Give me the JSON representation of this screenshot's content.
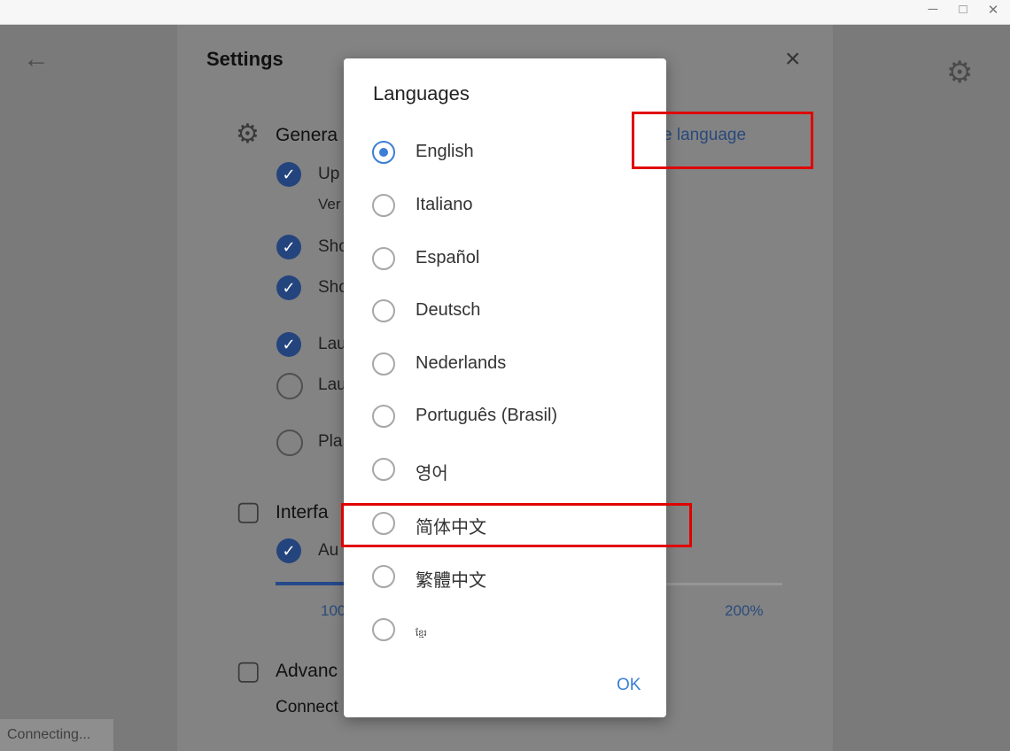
{
  "window": {
    "minimize_icon": "minimize-icon",
    "maximize_icon": "maximize-icon",
    "close_icon": "close-icon"
  },
  "settings": {
    "title": "Settings",
    "general": {
      "title": "Genera",
      "options": [
        {
          "label": "Up",
          "checked": true
        },
        {
          "label": "Ver",
          "checked": null
        },
        {
          "label": "Sho",
          "checked": true
        },
        {
          "label": "Sho",
          "checked": true
        },
        {
          "label": "Lau",
          "checked": true
        },
        {
          "label": "Lau",
          "checked": false
        },
        {
          "label": "Pla",
          "checked": false
        }
      ],
      "change_language": "e language"
    },
    "interface": {
      "title": "Interfa",
      "option": {
        "label": "Au",
        "checked": true
      },
      "slider_min": "100",
      "slider_max": "200%",
      "slider_value_fraction": 0.14
    },
    "advanced": {
      "title": "Advanc",
      "connect_label": "Connect"
    }
  },
  "status_bar": "Connecting...",
  "dialog": {
    "title": "Languages",
    "ok": "OK",
    "languages": [
      {
        "label": "English",
        "selected": true
      },
      {
        "label": "Italiano",
        "selected": false
      },
      {
        "label": "Español",
        "selected": false
      },
      {
        "label": "Deutsch",
        "selected": false
      },
      {
        "label": "Nederlands",
        "selected": false
      },
      {
        "label": "Português (Brasil)",
        "selected": false
      },
      {
        "label": "영어",
        "selected": false
      },
      {
        "label": "简体中文",
        "selected": false
      },
      {
        "label": "繁體中文",
        "selected": false
      },
      {
        "label": "ខ្មែរ",
        "selected": false
      }
    ]
  },
  "colors": {
    "accent": "#3a7fd5",
    "check": "#24447e",
    "highlight_box": "#e00000"
  }
}
